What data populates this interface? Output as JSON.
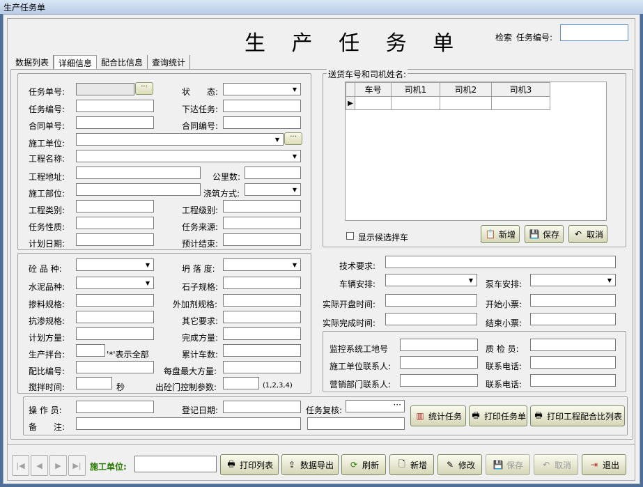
{
  "window_title": "生产任务单",
  "heading": "生 产 任 务 单",
  "search": {
    "label": "检索",
    "field_label": "任务编号:"
  },
  "tabs": [
    "数据列表",
    "详细信息",
    "配合比信息",
    "查询统计"
  ],
  "form1": {
    "task_no": "任务单号:",
    "status": "状　　态:",
    "task_code": "任务编号:",
    "issue_task": "下达任务:",
    "contract_no": "合同单号:",
    "contract_code": "合同编号:",
    "unit": "施工单位:",
    "project_name": "工程名称:",
    "project_addr": "工程地址:",
    "km": "公里数:",
    "part": "施工部位:",
    "pour_method": "浇筑方式:",
    "project_type": "工程类别:",
    "project_level": "工程级别:",
    "task_nature": "任务性质:",
    "task_source": "任务来源:",
    "plan_date": "计划日期:",
    "est_end": "预计结束:",
    "dots": "···"
  },
  "form2": {
    "concrete_type": "砼 品 种:",
    "slump": "坍 落 度:",
    "cement_type": "水泥品种:",
    "stone_spec": "石子规格:",
    "admix_spec": "掺料规格:",
    "additive_spec": "外加剂规格:",
    "impermeable": "抗渗规格:",
    "other_req": "其它要求:",
    "plan_volume": "计划方量:",
    "done_volume": "完成方量:",
    "station": "生产拌台:",
    "station_hint": "'*'表示全部",
    "total_cars": "累计车数:",
    "mix_no": "配比编号:",
    "max_per_batch": "每盘最大方量:",
    "mix_time": "搅拌时间:",
    "sec": "秒",
    "gate_param": "出砼门控制参数:",
    "gate_hint": "(1,2,3,4)"
  },
  "delivery": {
    "legend": "送货车号和司机姓名:",
    "columns": [
      "车号",
      "司机1",
      "司机2",
      "司机3"
    ],
    "show_candidates": "显示候选拌车",
    "add": "新增",
    "save": "保存",
    "cancel": "取消"
  },
  "right": {
    "tech_req": "技术要求:",
    "vehicle": "车辆安排:",
    "pump": "泵车安排:",
    "start_time": "实际开盘时间:",
    "start_ticket": "开始小票:",
    "end_time": "实际完成时间:",
    "end_ticket": "结束小票:",
    "monitor_site": "监控系统工地号",
    "inspector": "质 检 员:",
    "unit_contact": "施工单位联系人:",
    "phone1": "联系电话:",
    "sales_contact": "营销部门联系人:",
    "phone2": "联系电话:"
  },
  "bottom_form": {
    "operator": "操 作 员:",
    "reg_date": "登记日期:",
    "review": "任务复核:",
    "remark": "备　　注:",
    "dots": "···",
    "stat_btn": "统计任务",
    "print_task_btn": "打印任务单",
    "print_mix_btn": "打印工程配合比列表"
  },
  "footer": {
    "unit_label": "施工单位:",
    "print_list": "打印列表",
    "export": "数据导出",
    "refresh": "刷新",
    "add": "新增",
    "edit": "修改",
    "save": "保存",
    "cancel": "取消",
    "exit": "退出"
  },
  "colors": {
    "accent_green": "#2a7a00",
    "window_border": "#4d6f98"
  }
}
